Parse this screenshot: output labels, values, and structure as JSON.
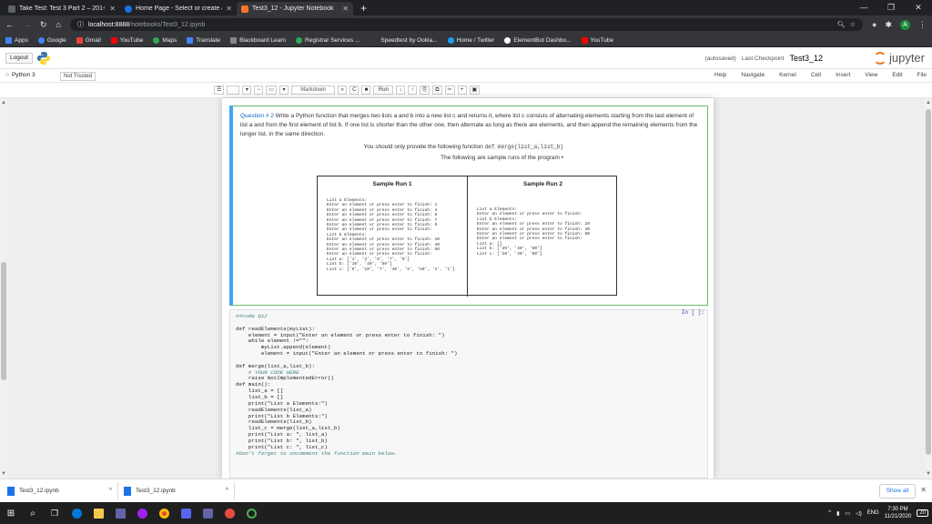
{
  "browser": {
    "tabs": [
      {
        "title": "Take Test: Test 3 Part 2 – 201-ICT-",
        "color": "#5f6368",
        "active": false
      },
      {
        "title": "Home Page - Select or create a",
        "color": "#1a73e8",
        "active": false
      },
      {
        "title": "Test3_12 - Jupyter Notebook",
        "color": "#f37726",
        "active": true
      }
    ],
    "new_tab": "+",
    "url_host": "localhost:8888",
    "url_path": "/notebooks/Test3_12.ipynb",
    "profile_letter": "A",
    "bookmarks": [
      {
        "label": "Apps",
        "color": "#4285f4"
      },
      {
        "label": "Google",
        "color": "#4285f4"
      },
      {
        "label": "Gmail",
        "color": "#ea4335"
      },
      {
        "label": "YouTube",
        "color": "#ff0000"
      },
      {
        "label": "Maps",
        "color": "#34a853"
      },
      {
        "label": "Translate",
        "color": "#4285f4"
      },
      {
        "label": "Blackboard Learn",
        "color": "#333333"
      },
      {
        "label": "Registrar Services ...",
        "color": "#34a853"
      },
      {
        "label": "Speedtest by Ookla...",
        "color": "#141526"
      },
      {
        "label": "Home / Twitter",
        "color": "#1da1f2"
      },
      {
        "label": "ElementBot Dashbo...",
        "color": "#ffffff"
      },
      {
        "label": "YouTube",
        "color": "#ff0000"
      }
    ]
  },
  "jupyter": {
    "logout": "Logout",
    "save_status": "(autosaved)",
    "checkpoint": "Last Checkpoint",
    "notebook_name": "Test3_12",
    "logo_text": "jupyter",
    "kernel_name": "Python 3",
    "not_trusted": "Not Trusted",
    "menus": [
      "File",
      "Edit",
      "View",
      "Insert",
      "Cell",
      "Kernel",
      "Navigate",
      "Help"
    ],
    "cell_type": "Markdown",
    "run_label": "Run"
  },
  "question": {
    "header": "Question # 2",
    "text1": "Write a Python function that merges two lists a and b into a new list c and returns it, where list c consists of alternating elements starting from the last element of list a and from the first element of list b. If one list is shorter than the other one, then alternate as long as there are elements, and then append the remaining elements from the longer list, in the same direction.",
    "provide": "You should only provide the following function",
    "provide_code": "def merge(list_a,list_b)",
    "sample_intro": "The following are sample runs of the program"
  },
  "sample_runs": [
    {
      "title": "Sample Run 1",
      "lines": [
        "List a Elements:",
        "Enter an element or press enter to finish: 1",
        "Enter an element or press enter to finish: 3",
        "Enter an element or press enter to finish: 5",
        "Enter an element or press enter to finish: 7",
        "Enter an element or press enter to finish: 9",
        "Enter an element or press enter to finish:",
        "List b Elements:",
        "Enter an element or press enter to finish: 10",
        "Enter an element or press enter to finish: 40",
        "Enter an element or press enter to finish: 50",
        "Enter an element or press enter to finish:",
        "List a: ['1', '3', '5', '7', '9']",
        "List b: ['10', '40', '50']",
        "List c: ['9', '10', '7', '40', '5', '50', '3', '1']"
      ]
    },
    {
      "title": "Sample Run 2",
      "lines": [
        "List a Elements:",
        "Enter an element or press enter to finish:",
        "List b Elements:",
        "Enter an element or press enter to finish: 20",
        "Enter an element or press enter to finish: 40",
        "Enter an element or press enter to finish: 60",
        "Enter an element or press enter to finish:",
        "List a: []",
        "List b: ['20', '40', '60']",
        "List c: ['20', '40', '60']"
      ]
    }
  ],
  "code_cell": {
    "prompt": "In [ ]:",
    "lines": [
      "##code Q12",
      "",
      "def readElements(myList):",
      "    element = input(\"Enter an element or press enter to finish: \")",
      "    while element !=\"\":",
      "        myList.append(element)",
      "        element = input(\"Enter an element or press enter to finish: \")",
      "",
      "def merge(list_a,list_b):",
      "    # YOUR CODE HERE",
      "    raise NotImplementedError()",
      "def main():",
      "    list_a = []",
      "    list_b = []",
      "    print(\"List a Elements:\")",
      "    readElements(list_a)",
      "    print(\"List b Elements:\")",
      "    readElements(list_b)",
      "    list_c = merge(list_a,list_b)",
      "    print(\"List a: \", list_a)",
      "    print(\"List b: \", list_b)",
      "    print(\"List c: \", list_c)",
      "#Don't forget to uncomment the function main below."
    ]
  },
  "downloads": {
    "items": [
      "Test3_12.ipynb",
      "Test3_12.ipynb"
    ],
    "show_all": "Show all"
  },
  "taskbar": {
    "time": "7:30 PM",
    "date": "11/21/2020",
    "lang": "ENG",
    "notif_count": "20"
  }
}
